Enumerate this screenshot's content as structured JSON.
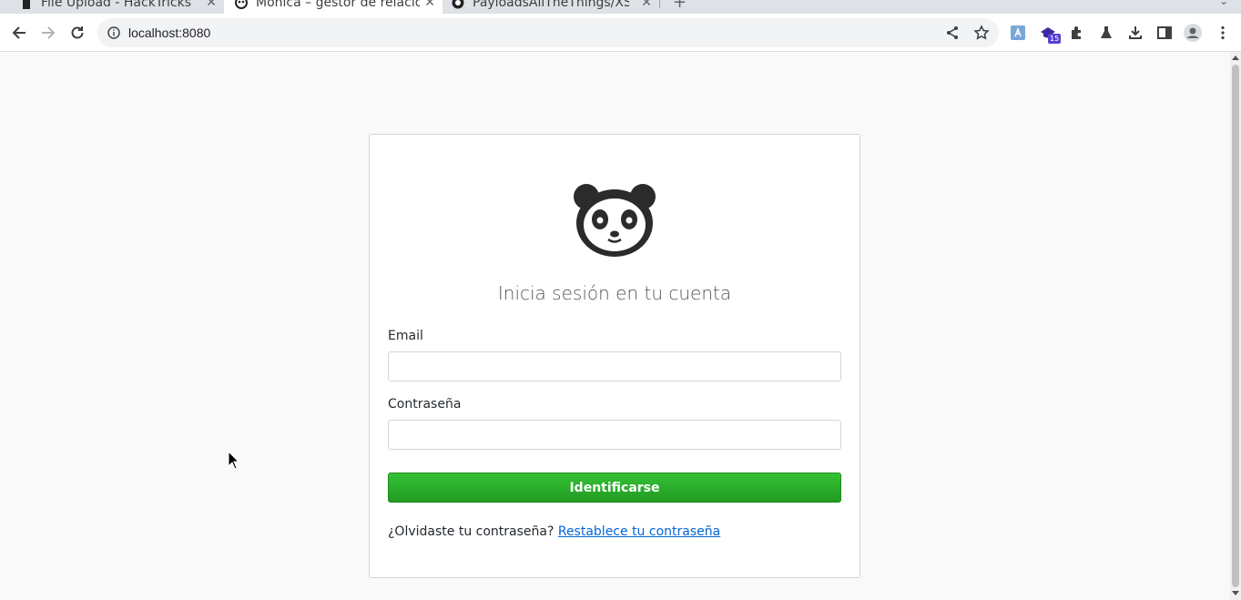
{
  "browser": {
    "tabs": [
      {
        "title": "File Upload - HackTricks",
        "active": false
      },
      {
        "title": "Monica – gestor de relacio",
        "active": true
      },
      {
        "title": "PayloadsAllTheThings/XSS",
        "active": false
      }
    ],
    "new_tab_label": "+",
    "url": "localhost:8080",
    "extension_badge": "15"
  },
  "login": {
    "title": "Inicia sesión en tu cuenta",
    "email_label": "Email",
    "email_value": "",
    "password_label": "Contraseña",
    "password_value": "",
    "submit_label": "Identificarse",
    "forgot_text": "¿Olvidaste tu contraseña?",
    "reset_link": "Restablece tu contraseña"
  },
  "colors": {
    "submit_green": "#239b23",
    "link_blue": "#0366d6",
    "page_bg": "#f9f9f9"
  },
  "icons": [
    "back-icon",
    "forward-icon",
    "reload-icon",
    "info-icon",
    "share-icon",
    "star-icon",
    "translate-icon",
    "extension-badge-icon",
    "puzzle-icon",
    "labs-icon",
    "download-icon",
    "sidepanel-icon",
    "profile-icon",
    "menu-icon",
    "panda-logo"
  ]
}
